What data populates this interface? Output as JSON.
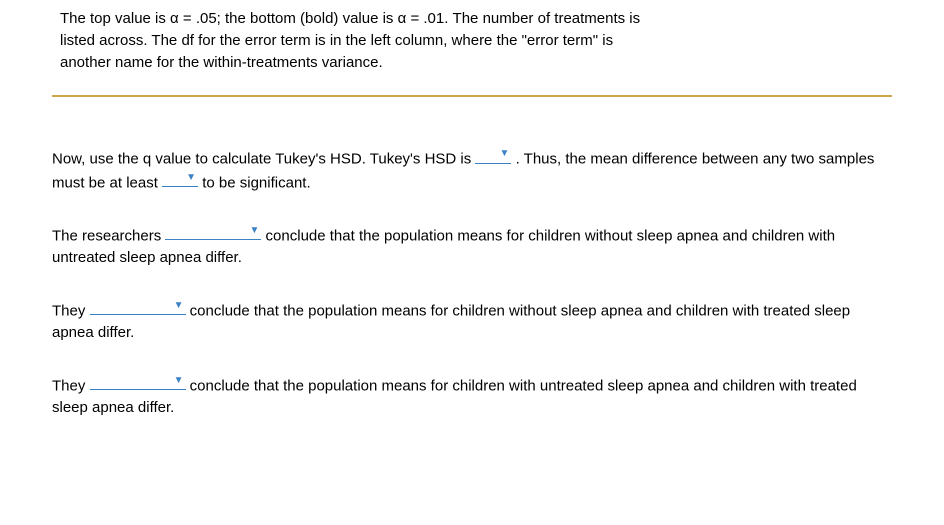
{
  "intro": {
    "line1_a": "The top value is α = .05; the bottom (bold) value is α = .01. The number of treatments is",
    "line1_b": "listed across. The df for the error term is in the left column, where the \"error term\" is",
    "line1_c": "another name for the within-treatments variance."
  },
  "para1": {
    "a": "Now, use the q value to calculate Tukey's HSD. Tukey's HSD is ",
    "b": " . Thus, the mean difference between any two samples must be at least ",
    "c": " to be significant."
  },
  "para2": {
    "a": "The researchers ",
    "b": " conclude that the population means for children without sleep apnea and children with untreated sleep apnea differ."
  },
  "para3": {
    "a": "They ",
    "b": " conclude that the population means for children without sleep apnea and children with treated sleep apnea differ."
  },
  "para4": {
    "a": "They ",
    "b": " conclude that the population means for children with untreated sleep apnea and children with treated sleep apnea differ."
  },
  "dropdowns": {
    "tukey_hsd": "",
    "mean_diff": "",
    "researchers": "",
    "they1": "",
    "they2": ""
  }
}
